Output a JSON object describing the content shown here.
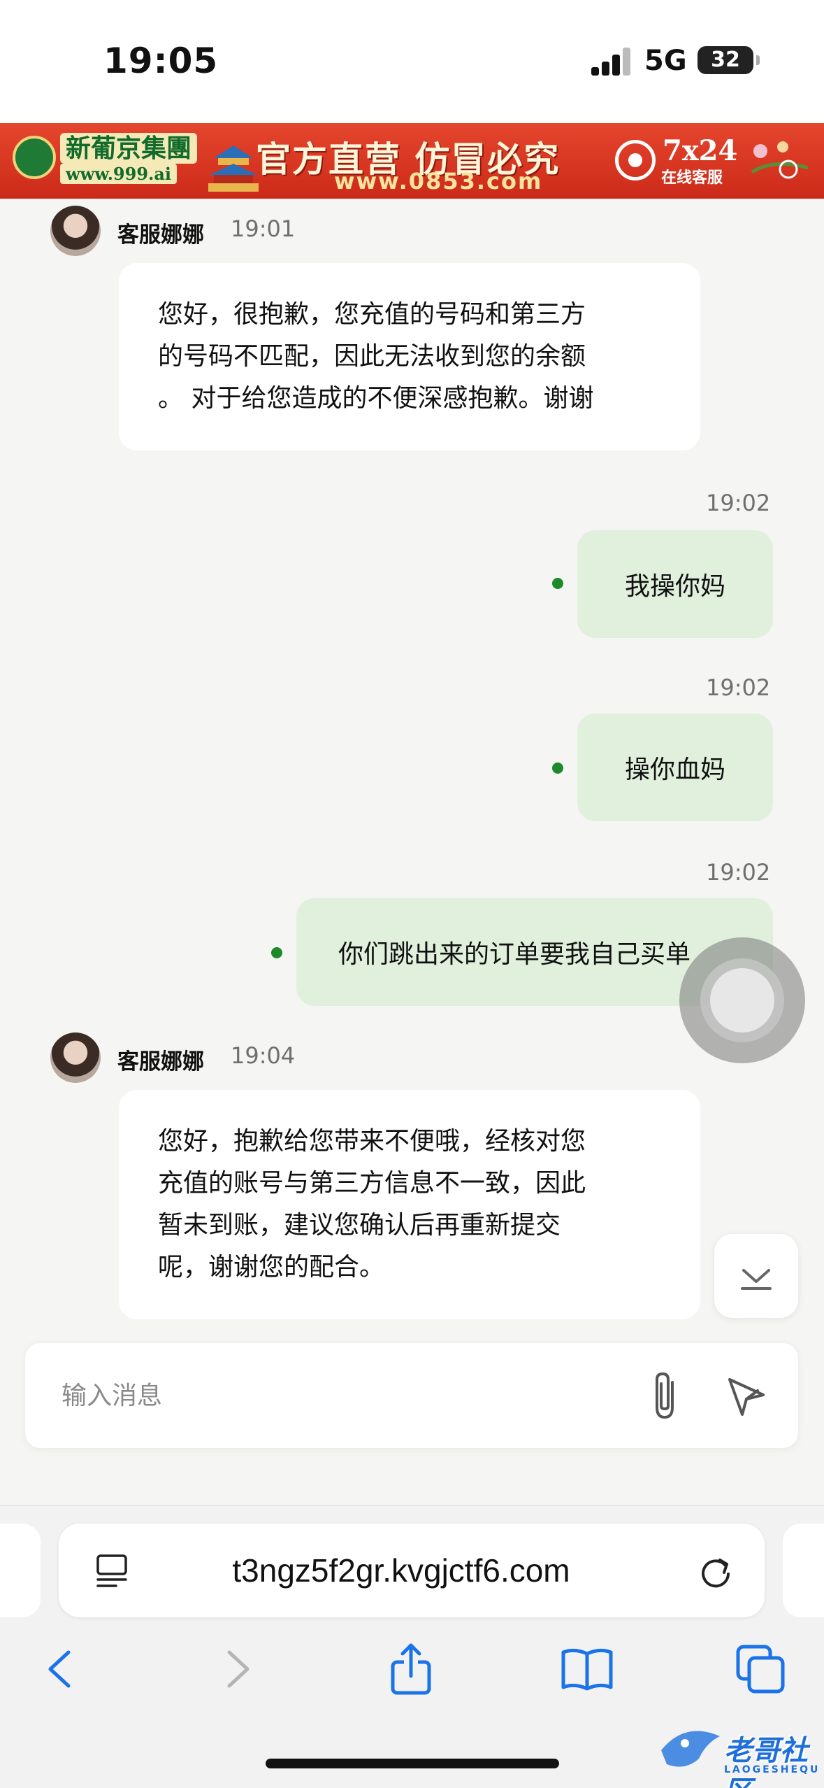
{
  "status_bar": {
    "time": "19:05",
    "network": "5G",
    "battery": "32"
  },
  "banner": {
    "logo_text": "新葡京集團",
    "logo_url": "www.999.ai",
    "slogan": "官方直营  仿冒必究",
    "domain": "www.0853.com",
    "service_big": "7x24",
    "service_small": "在线客服"
  },
  "messages": [
    {
      "direction": "in",
      "sender": "客服娜娜",
      "time": "19:01",
      "lines": [
        "您好，很抱歉，您充值的号码和第三方",
        "的号码不匹配，因此无法收到您的余额",
        "。 对于给您造成的不便深感抱歉。谢谢"
      ]
    },
    {
      "direction": "out",
      "time": "19:02",
      "text": "我操你妈"
    },
    {
      "direction": "out",
      "time": "19:02",
      "text": "操你血妈"
    },
    {
      "direction": "out",
      "time": "19:02",
      "text": "你们跳出来的订单要我自己买单"
    },
    {
      "direction": "in",
      "sender": "客服娜娜",
      "time": "19:04",
      "lines": [
        "您好，抱歉给您带来不便哦，经核对您",
        "充值的账号与第三方信息不一致，因此",
        "暂未到账，建议您确认后再重新提交",
        "呢，谢谢您的配合。"
      ]
    }
  ],
  "composer": {
    "placeholder": "输入消息"
  },
  "browser": {
    "url": "t3ngz5f2gr.kvgjctf6.com"
  },
  "watermark": {
    "text": "老哥社区",
    "sub": "LAOGESHEQU"
  },
  "colors": {
    "accent_green": "#1d8a2a",
    "outgoing_bubble": "#e1f0dd",
    "safari_blue": "#1a73e8",
    "banner_red": "#d8321f"
  }
}
